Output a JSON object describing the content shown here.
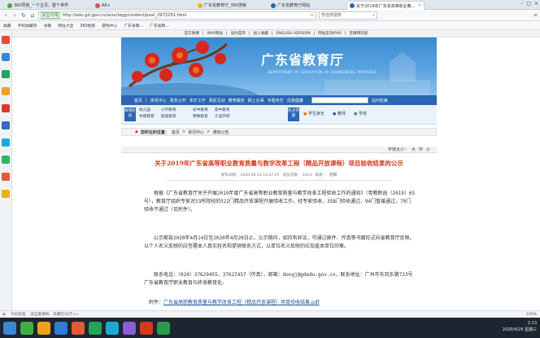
{
  "browser": {
    "tabs": [
      {
        "label": "360导航_一个主页，整个世界",
        "color": "#3fae3f"
      },
      {
        "label": "A8+",
        "color": "#d9534f"
      },
      {
        "label": "广东省教育厅_360搜索",
        "color": "#e8b400"
      },
      {
        "label": "广东省教育厅网站",
        "color": "#2a66b3"
      },
      {
        "label": "关于2019年广东省高等职业教...",
        "color": "#2a66b3"
      }
    ],
    "safe_label": "安全/可靠",
    "url": "http://edu.gd.gov.cn/zxzx/tzgg/content/post_2972251.html",
    "search_text": "李佳琦退款",
    "bookmarks": [
      "收藏",
      "手机收藏夹",
      "谷歌",
      "网址大全",
      "360搜索",
      "游戏中心",
      "广东省教...",
      "广东省教..."
    ]
  },
  "site": {
    "top_links": [
      "官方微博",
      "WAP网站",
      "设为首页",
      "加入收藏",
      "ENGLISH VERSION",
      "网站支持IPV6",
      "无障碍浏览"
    ],
    "banner_title": "广东省教育厅",
    "banner_subtitle": "DEPARTMENT OF EDUCATION OF GUANGDONG PROVINCE",
    "nav": [
      "首页",
      "资讯中心",
      "政务公开",
      "本厅工作",
      "政民互动",
      "教育服务",
      "网上办事",
      "专题专栏",
      "反腐倡廉"
    ],
    "nav_more": "站内检索",
    "subnav_label": "教育阶段",
    "stages": [
      "幼儿园",
      "小学教育",
      "初中教育",
      "高中教育",
      "中职教育",
      "高等教育",
      "特殊教育",
      "工读学校"
    ],
    "service_label": "热点专题",
    "services": [
      "学生家长",
      "教师",
      "学校"
    ],
    "breadcrumb_prefix": "您所在的位置：",
    "breadcrumb": [
      "首页",
      "资讯中心",
      "通知公告"
    ],
    "font_label": "字体大小：",
    "font_sizes": [
      "大",
      "中",
      "小"
    ]
  },
  "article": {
    "title": "关于2019年广东省高等职业教育质量与教学改革工程（精品开放课程）项目验收结果的公示",
    "meta_date": "发布日期： 2020-04-14 14:47:25",
    "meta_source": "浏览次数： 2414",
    "meta_share": "来源：",
    "meta_print": "打印",
    "p1": "根据《广东省教育厅关于开展2019年度广东省高等职业教育质量与教学改革工程验收工作的通知》（粤教职函〔2019〕65号），教育厅组织专家对53所院校的522门精品开放课程开展验收工作。经专家验收，358门验收通过，94门暂缓通过，70门验收不通过（见附件）。",
    "p2": "公示期自2020年4月14日至2020年4月20日止。公示期内，如持有异议，可通过邮件、传真等书面形式向省教育厅反映。以个人名义反映的应签署本人真实姓名和提供联系方式，以单位名义反映的应加盖本单位印章。",
    "p3": "联系电话：（020）37629455、37627457（传真），邮箱：dongj@gdedu.gov.cn，联系地址：广州市东风东路723号广东省教育厅职业教育与终身教育处。",
    "attach_label": "附件：",
    "attach_link": "广东省高职教育质量与教学改革工程（精品开放课程）项目验收结果.pdf"
  },
  "statusbar": {
    "left": "今日优选",
    "news": "谈全套柳林，日赚元10万++",
    "zoom": "100%"
  },
  "taskbar": {
    "time": "2:13",
    "date": "2020/4/29 星期三"
  }
}
